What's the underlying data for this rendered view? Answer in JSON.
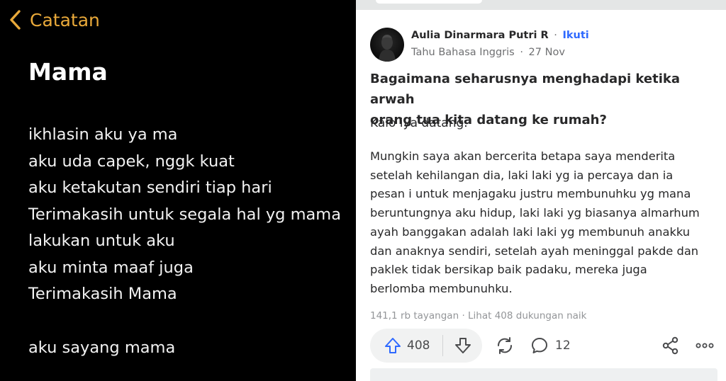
{
  "notes": {
    "back_label": "Catatan",
    "title": "Mama",
    "lines": [
      "ikhlasin aku ya ma",
      "aku uda capek, nggk kuat",
      "aku ketakutan sendiri tiap hari",
      "Terimakasih untuk segala hal yg mama",
      "lakukan untuk aku",
      "aku minta maaf juga",
      "Terimakasih Mama",
      "aku sayang mama"
    ],
    "colors": {
      "background": "#000000",
      "accent": "#e9a93a",
      "text": "#ffffff"
    },
    "icons": {
      "back": "chevron-left-icon"
    }
  },
  "post": {
    "author": {
      "name": "Aulia Dinarmara Putri R",
      "separator": "·",
      "follow_label": "Ikuti",
      "credential": "Tahu Bahasa Inggris",
      "date": "27 Nov"
    },
    "question": {
      "line1": "Bagaimana seharusnya menghadapi ketika arwah",
      "line2": "orang tua kita datang ke rumah?"
    },
    "detail": "Kalo iya datang.",
    "answer_lines": [
      "Mungkin saya akan bercerita betapa saya menderita",
      "setelah kehilangan dia, laki laki yg ia percaya dan ia",
      "pesan i untuk menjagaku justru membunuhku yg mana",
      "beruntungnya aku hidup, laki laki yg biasanya almarhum",
      "ayah banggakan adalah laki laki yg membunuh anakku",
      "dan anaknya sendiri, setelah ayah meninggal pakde dan",
      "paklek tidak bersikap baik padaku, mereka juga",
      "berlomba membunuhku."
    ],
    "stats": {
      "views": "141,1 rb tayangan",
      "separator": "·",
      "upvotes_link": "Lihat 408 dukungan naik"
    },
    "actions": {
      "upvote_count": "408",
      "comment_count": "12"
    },
    "colors": {
      "link": "#2e69ff",
      "text": "#282829",
      "muted": "#6f7072",
      "pill": "#f1f2f2",
      "upvote": "#2e69ff"
    },
    "icons": {
      "upvote": "arrow-up-icon",
      "downvote": "arrow-down-icon",
      "repost": "repost-icon",
      "comment": "comment-icon",
      "share": "share-icon",
      "more": "more-icon"
    }
  }
}
